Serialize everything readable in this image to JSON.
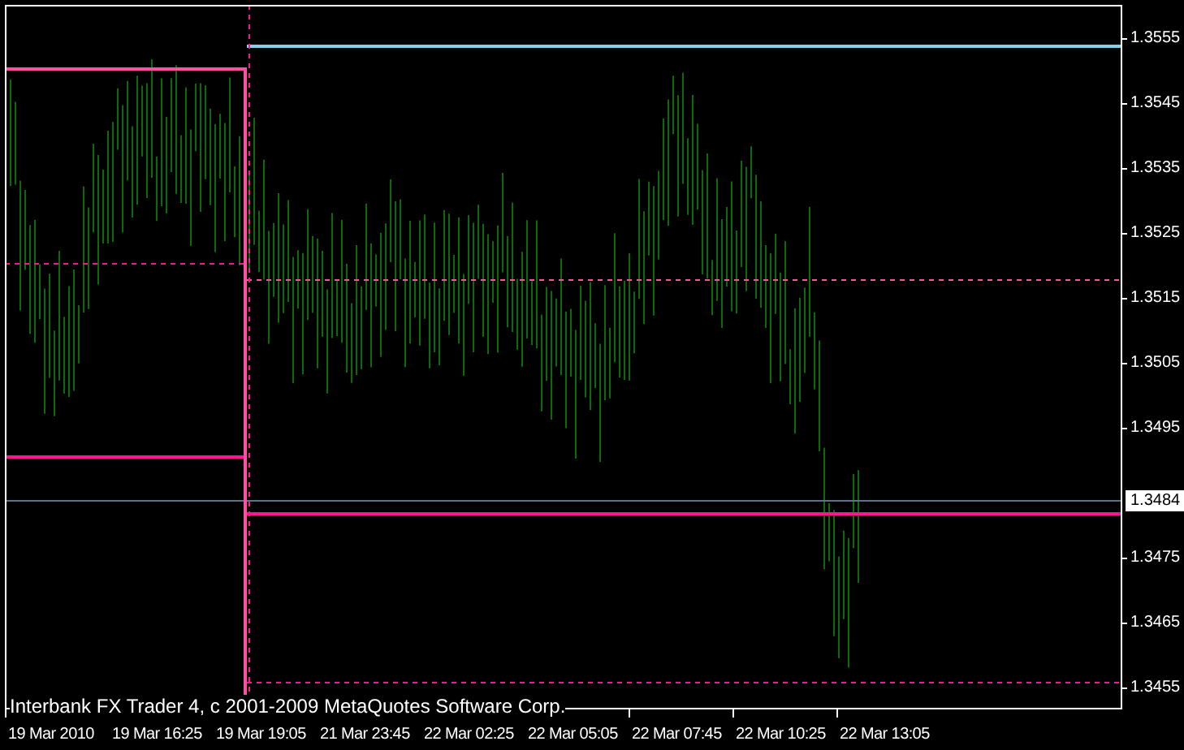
{
  "y_axis": {
    "labels": [
      "1.3555",
      "1.3545",
      "1.3535",
      "1.3525",
      "1.3515",
      "1.3505",
      "1.3495",
      "1.3475",
      "1.3465",
      "1.3455"
    ]
  },
  "current_price": {
    "label": "1.3484"
  },
  "x_axis": {
    "labels": [
      "19 Mar 2010",
      "19 Mar 16:25",
      "19 Mar 19:05",
      "21 Mar 23:45",
      "22 Mar 02:25",
      "22 Mar 05:05",
      "22 Mar 07:45",
      "22 Mar 10:25",
      "22 Mar 13:05"
    ]
  },
  "copyright": "Interbank FX Trader 4, c 2001-2009 MetaQuotes Software Corp."
}
